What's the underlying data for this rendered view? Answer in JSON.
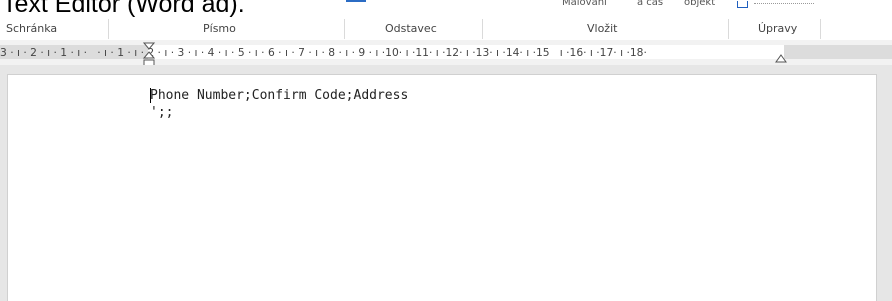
{
  "window": {
    "caption": "Text Editor (Word ad)."
  },
  "ribbon": {
    "top_partial_labels": [
      "Malování",
      "a čas",
      "objekt"
    ],
    "groups": [
      {
        "id": "clipboard",
        "label": "Schránka"
      },
      {
        "id": "font",
        "label": "Písmo"
      },
      {
        "id": "paragraph",
        "label": "Odstavec"
      },
      {
        "id": "insert",
        "label": "Vložit"
      },
      {
        "id": "editing",
        "label": "Úpravy"
      }
    ]
  },
  "ruler": {
    "text": "3 · ı · 2 · ı · 1 · ı ·   · ı · 1 · ı · 2 · ı · 3 · ı · 4 · ı · 5 · ı · 6 · ı · 7 · ı · 8 · ı · 9 · ı ·10· ı ·11· ı ·12· ı ·13· ı ·14· ı ·15   ı ·16· ı ·17· ı ·18·"
  },
  "document": {
    "lines": [
      "Phone Number;Confirm Code;Address",
      "';;"
    ]
  },
  "colors": {
    "accent": "#2b6cc4",
    "workspace": "#e6e6e6",
    "ruler_margin": "#dcdcdc"
  }
}
